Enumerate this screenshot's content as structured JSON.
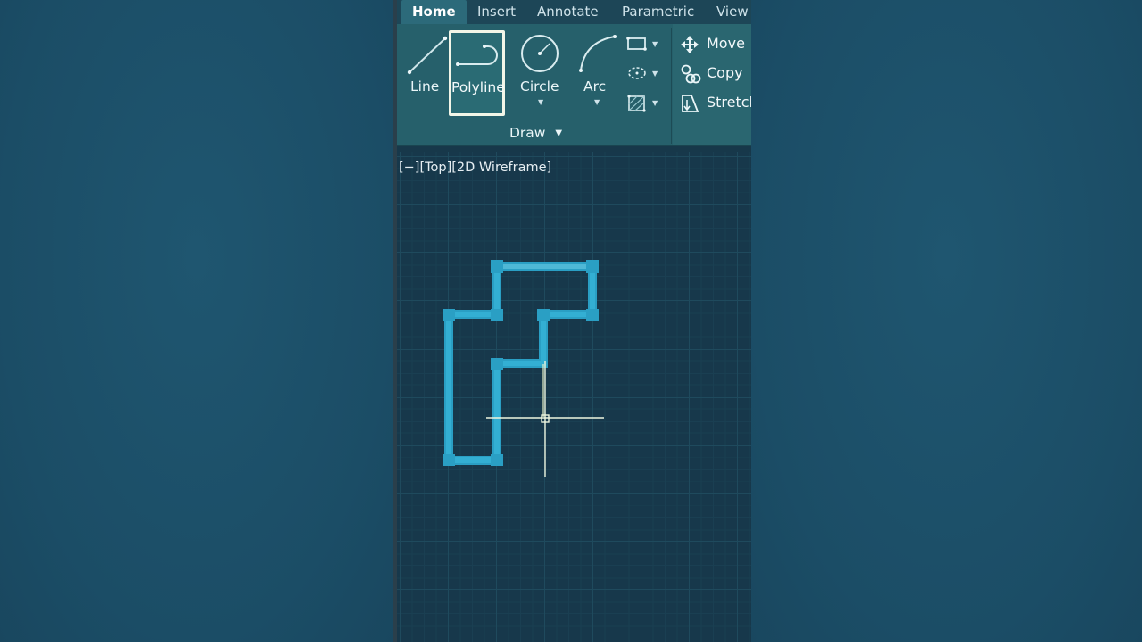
{
  "ribbon_tabs": [
    "Home",
    "Insert",
    "Annotate",
    "Parametric",
    "View"
  ],
  "draw_tools": {
    "line": "Line",
    "polyline": "Polyline",
    "circle": "Circle",
    "arc": "Arc"
  },
  "draw_panel_label": "Draw",
  "modify_tools": {
    "move": "Move",
    "copy": "Copy",
    "stretch": "Stretch"
  },
  "viewport_label": "[−][Top][2D Wireframe]",
  "icons": {
    "panel_menu": "caret-down-icon",
    "rectangle": "rectangle-icon",
    "ellipse": "ellipse-icon",
    "hatch": "hatch-icon",
    "move": "move-arrows-icon",
    "copy": "copy-icon",
    "stretch": "stretch-icon",
    "cursor": "crosshair-cursor-icon"
  },
  "colors": {
    "accent": "#2a9fc4",
    "ribbon": "#26606b",
    "canvas": "#17384b",
    "selection_box": "#f2f6e8"
  }
}
